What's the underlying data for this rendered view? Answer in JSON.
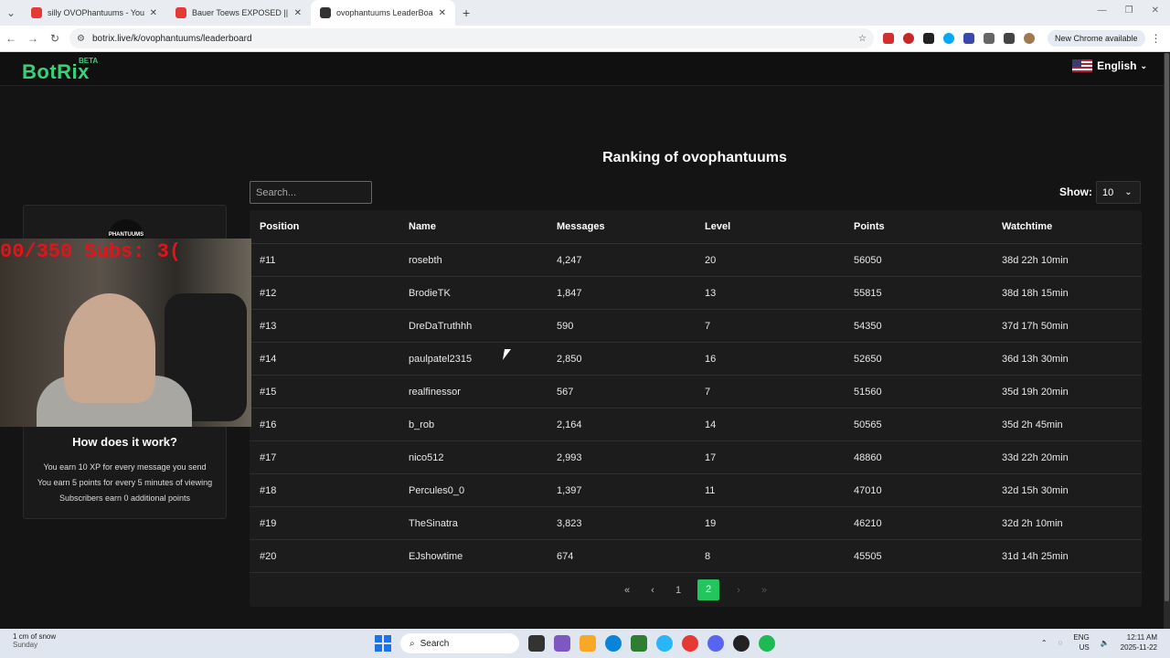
{
  "browser": {
    "tabs": [
      {
        "title": "silly OVOPhantuums - YouTube",
        "active": false,
        "favicon_color": "#e53935"
      },
      {
        "title": "Bauer Toews EXPOSED || Caugh",
        "active": false,
        "favicon_color": "#e53935"
      },
      {
        "title": "ovophantuums LeaderBoard | T",
        "active": true,
        "favicon_color": "#333333"
      }
    ],
    "url": "botrix.live/k/ovophantuums/leaderboard",
    "new_chrome_label": "New Chrome available"
  },
  "site": {
    "logo": "BotRix",
    "beta": "BETA",
    "language": "English"
  },
  "leaderboard": {
    "title": "Ranking of ovophantuums",
    "search_placeholder": "Search...",
    "show_label": "Show:",
    "show_value": "10",
    "columns": [
      "Position",
      "Name",
      "Messages",
      "Level",
      "Points",
      "Watchtime"
    ],
    "rows": [
      [
        "#11",
        "rosebth",
        "4,247",
        "20",
        "56050",
        "38d 22h 10min"
      ],
      [
        "#12",
        "BrodieTK",
        "1,847",
        "13",
        "55815",
        "38d 18h 15min"
      ],
      [
        "#13",
        "DreDaTruthhh",
        "590",
        "7",
        "54350",
        "37d 17h 50min"
      ],
      [
        "#14",
        "paulpatel2315",
        "2,850",
        "16",
        "52650",
        "36d 13h 30min"
      ],
      [
        "#15",
        "realfinessor",
        "567",
        "7",
        "51560",
        "35d 19h 20min"
      ],
      [
        "#16",
        "b_rob",
        "2,164",
        "14",
        "50565",
        "35d 2h 45min"
      ],
      [
        "#17",
        "nico512",
        "2,993",
        "17",
        "48860",
        "33d 22h 20min"
      ],
      [
        "#18",
        "Percules0_0",
        "1,397",
        "11",
        "47010",
        "32d 15h 30min"
      ],
      [
        "#19",
        "TheSinatra",
        "3,823",
        "19",
        "46210",
        "32d 2h 10min"
      ],
      [
        "#20",
        "EJshowtime",
        "674",
        "8",
        "45505",
        "31d 14h 25min"
      ]
    ],
    "pager": {
      "first": "«",
      "prev": "‹",
      "pages": [
        "1",
        "2"
      ],
      "current": "2",
      "next": "›",
      "last": "»"
    }
  },
  "sidebar": {
    "avatar_text": "PHANTUUMS",
    "how_title": "How does it work?",
    "lines": [
      "You earn 10 XP for every message you send",
      "You earn 5 points for every 5 minutes of viewing",
      "Subscribers earn 0 additional points"
    ]
  },
  "webcam": {
    "overlay_text": "00/350  Subs: 3("
  },
  "taskbar": {
    "weather": "1 cm of snow",
    "weather_sub": "Sunday",
    "search": "Search",
    "lang": "ENG",
    "region": "US",
    "time": "12:11 AM",
    "date": "2025-11-22"
  }
}
